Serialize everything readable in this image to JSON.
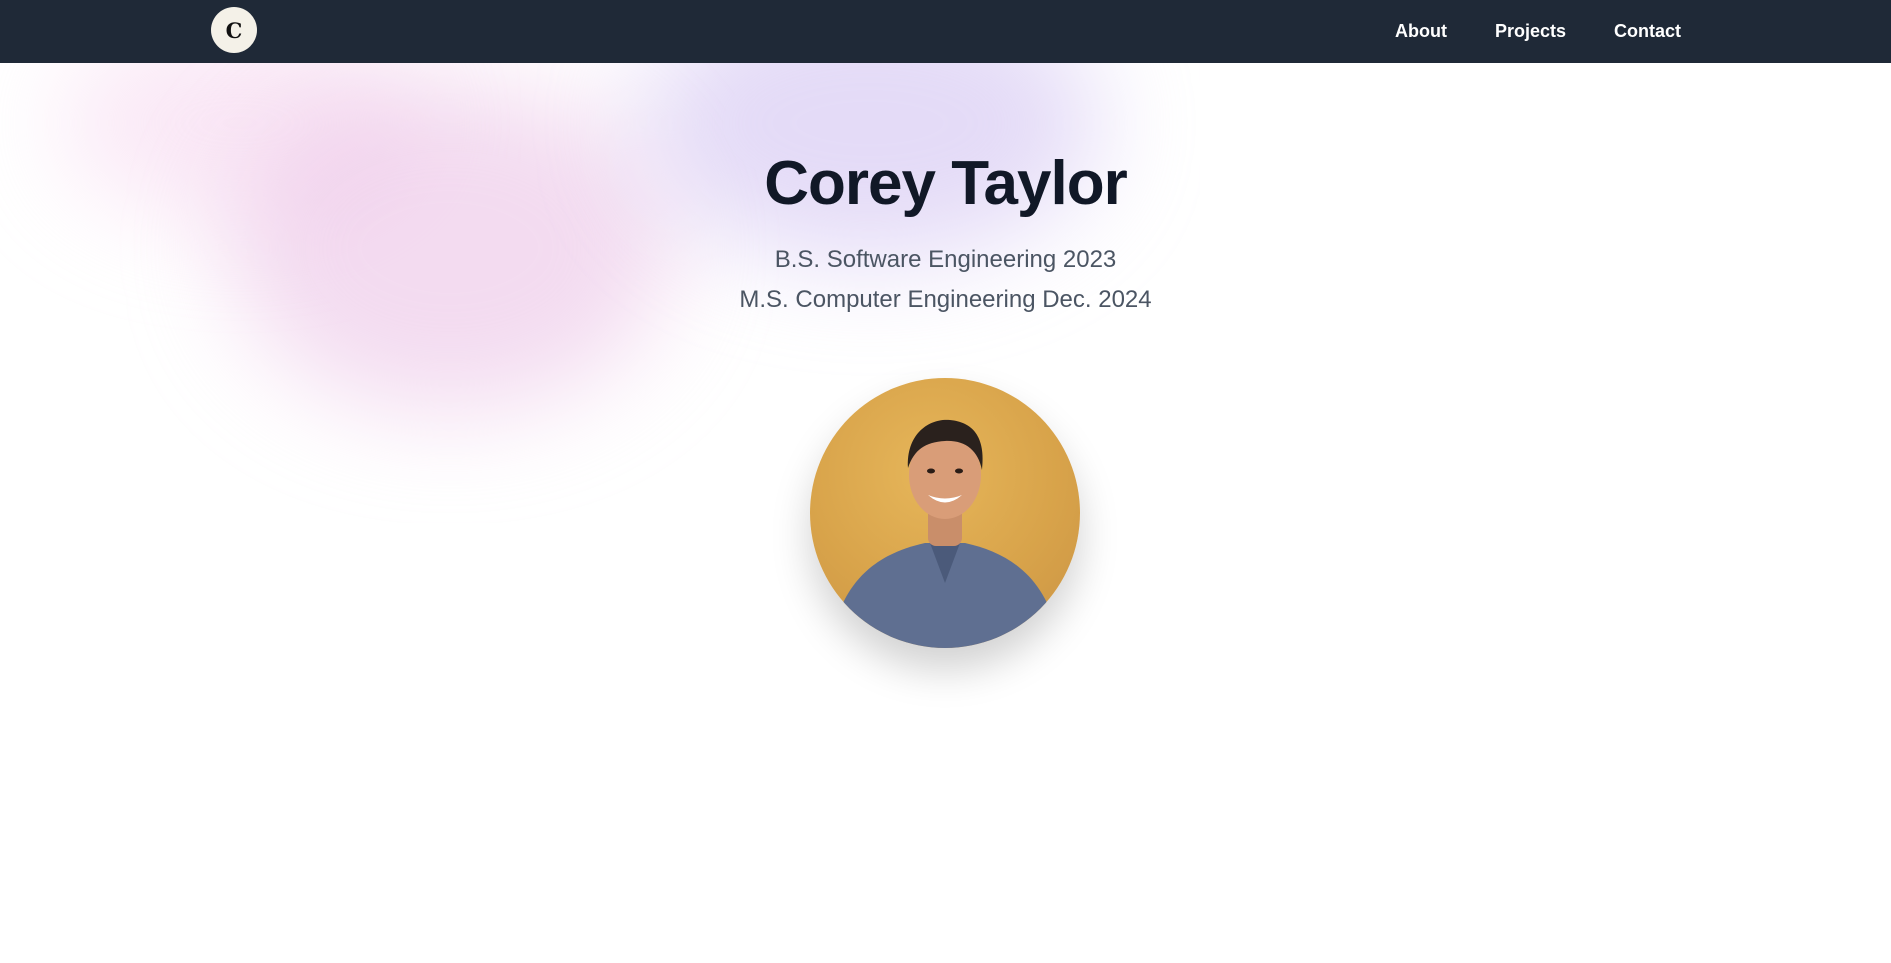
{
  "nav": {
    "logo_letter": "C",
    "links": [
      "About",
      "Projects",
      "Contact"
    ]
  },
  "hero": {
    "name": "Corey Taylor",
    "degrees": [
      "B.S. Software Engineering 2023",
      "M.S. Computer Engineering Dec. 2024"
    ]
  },
  "colors": {
    "nav_bg": "#1f2937",
    "name_text": "#111827",
    "degree_text": "#4b5563",
    "photo_bg": "#d8a34a"
  },
  "icons": {
    "logo": "monogram-c-icon"
  }
}
